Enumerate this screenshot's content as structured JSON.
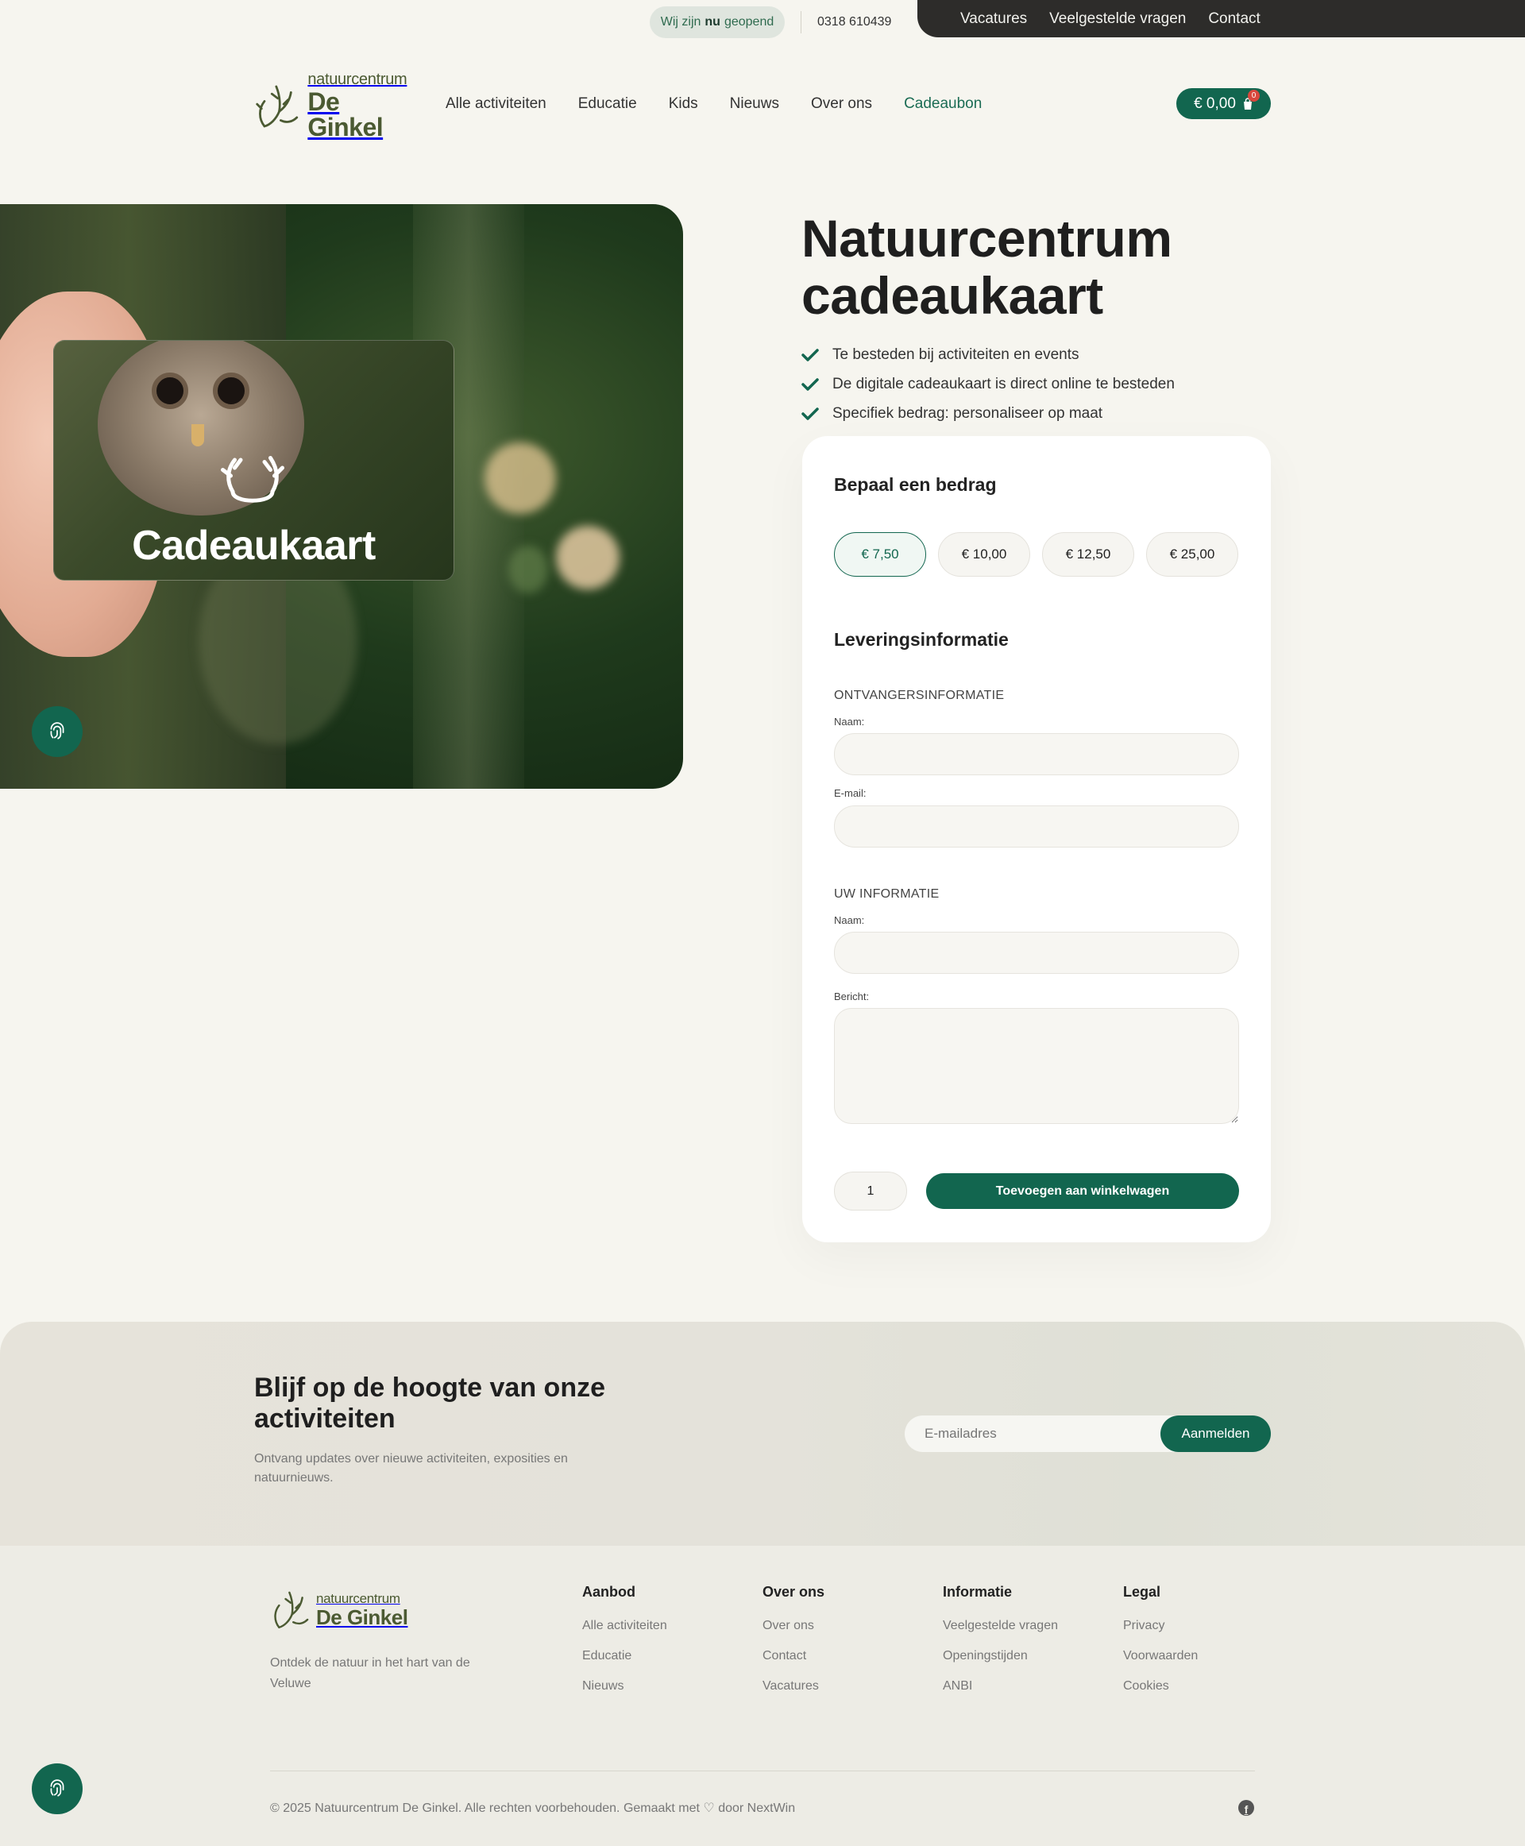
{
  "topbar": {
    "open_prefix": "Wij zijn",
    "open_bold": "nu",
    "open_suffix": "geopend",
    "phone": "0318 610439",
    "links": [
      "Vacatures",
      "Veelgestelde vragen",
      "Contact"
    ]
  },
  "header": {
    "logo_small": "natuurcentrum",
    "logo_big": "De Ginkel",
    "nav": [
      "Alle activiteiten",
      "Educatie",
      "Kids",
      "Nieuws",
      "Over ons",
      "Cadeaubon"
    ],
    "active_nav": "Cadeaubon",
    "cart_total": "€ 0,00",
    "cart_count": "0"
  },
  "hero": {
    "card_title": "Cadeaukaart",
    "title": "Natuurcentrum cadeaukaart",
    "benefits": [
      "Te besteden bij activiteiten en events",
      "De digitale cadeaukaart is direct online te besteden",
      "Specifiek bedrag: personaliseer op maat"
    ]
  },
  "form": {
    "amount_heading": "Bepaal een bedrag",
    "amounts": [
      "€ 7,50",
      "€ 10,00",
      "€ 12,50",
      "€ 25,00"
    ],
    "selected_amount": "€ 7,50",
    "delivery_heading": "Leveringsinformatie",
    "recipient_section": "ONTVANGERSINFORMATIE",
    "recipient_name_label": "Naam:",
    "recipient_email_label": "E-mail:",
    "your_section": "UW INFORMATIE",
    "your_name_label": "Naam:",
    "message_label": "Bericht:",
    "quantity": "1",
    "add_button": "Toevoegen aan winkelwagen"
  },
  "newsletter": {
    "title": "Blijf op de hoogte van onze activiteiten",
    "subtitle": "Ontvang updates over nieuwe activiteiten, exposities en natuurnieuws.",
    "email_placeholder": "E-mailadres",
    "button": "Aanmelden"
  },
  "footer": {
    "description": "Ontdek de natuur in het hart van de Veluwe",
    "columns": [
      {
        "title": "Aanbod",
        "links": [
          "Alle activiteiten",
          "Educatie",
          "Nieuws"
        ]
      },
      {
        "title": "Over ons",
        "links": [
          "Over ons",
          "Contact",
          "Vacatures"
        ]
      },
      {
        "title": "Informatie",
        "links": [
          "Veelgestelde vragen",
          "Openingstijden",
          "ANBI"
        ]
      },
      {
        "title": "Legal",
        "links": [
          "Privacy",
          "Voorwaarden",
          "Cookies"
        ]
      }
    ],
    "copyright": "© 2025 Natuurcentrum De Ginkel. Alle rechten voorbehouden. Gemaakt met ♡ door NextWin"
  },
  "colors": {
    "brand_green": "#12664f",
    "logo_olive": "#4b5a32",
    "background": "#f6f5ef",
    "top_bar_dark": "#2d2c2a"
  }
}
